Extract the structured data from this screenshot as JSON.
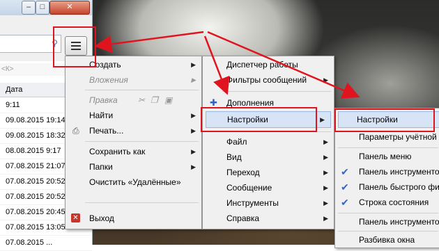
{
  "window": {
    "minimize": "–",
    "maximize": "□",
    "close": "✕",
    "search_hint": "<К>"
  },
  "columns": {
    "date": "Дата"
  },
  "dates": [
    "9:11",
    "09.08.2015 19:14",
    "09.08.2015 18:32",
    "08.08.2015 9:17",
    "07.08.2015 21:07",
    "07.08.2015 20:52",
    "07.08.2015 20:52",
    "07.08.2015 20:45",
    "07.08.2015 13:05",
    "07.08.2015 ..."
  ],
  "main_menu": {
    "items": [
      "Создать",
      "Вложения",
      "Правка",
      "Найти",
      "Печать...",
      "Сохранить как",
      "Папки",
      "Очистить «Удалённые»",
      "Выход"
    ]
  },
  "app_menu": {
    "items": [
      "Диспетчер работы",
      "Фильтры сообщений",
      "Дополнения",
      "Настройки",
      "Файл",
      "Вид",
      "Переход",
      "Сообщение",
      "Инструменты",
      "Справка"
    ]
  },
  "settings_submenu": {
    "items": [
      "Настройки",
      "Параметры учётной з",
      "Панель меню",
      "Панель инструментов",
      "Панель быстрого фи",
      "Строка состояния",
      "Панель инструментов",
      "Разбивка окна"
    ]
  }
}
